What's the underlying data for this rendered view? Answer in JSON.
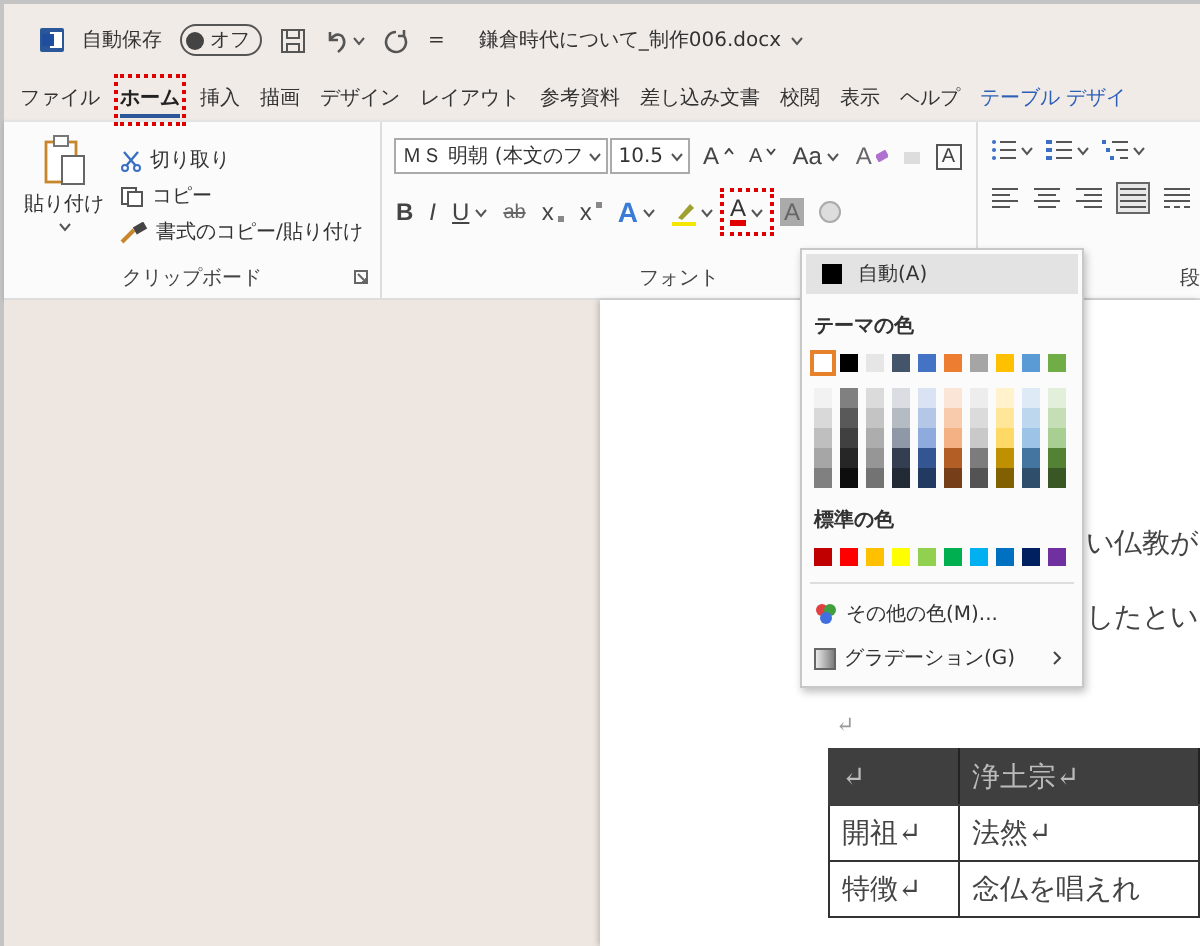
{
  "title_bar": {
    "autosave_label": "自動保存",
    "autosave_toggle": {
      "label": "オフ",
      "on": false
    },
    "customize": "=",
    "file_name": "鎌倉時代について_制作006.docx"
  },
  "tabs": [
    {
      "label": "ファイル",
      "selected": false,
      "contextual": false
    },
    {
      "label": "ホーム",
      "selected": true,
      "callout": true,
      "contextual": false
    },
    {
      "label": "挿入",
      "selected": false,
      "contextual": false
    },
    {
      "label": "描画",
      "selected": false,
      "contextual": false
    },
    {
      "label": "デザイン",
      "selected": false,
      "contextual": false
    },
    {
      "label": "レイアウト",
      "selected": false,
      "contextual": false
    },
    {
      "label": "参考資料",
      "selected": false,
      "contextual": false
    },
    {
      "label": "差し込み文書",
      "selected": false,
      "contextual": false
    },
    {
      "label": "校閲",
      "selected": false,
      "contextual": false
    },
    {
      "label": "表示",
      "selected": false,
      "contextual": false
    },
    {
      "label": "ヘルプ",
      "selected": false,
      "contextual": false
    },
    {
      "label": "テーブル デザイ",
      "selected": false,
      "contextual": true
    }
  ],
  "ribbon": {
    "clipboard": {
      "paste": "貼り付け",
      "cut": "切り取り",
      "copy": "コピー",
      "format_painter": "書式のコピー/貼り付け",
      "label": "クリップボード"
    },
    "font": {
      "font_name": "ＭＳ 明朝 (本文のフ",
      "font_size": "10.5",
      "row1": [
        {
          "kind": "grow",
          "label": "A"
        },
        {
          "kind": "shrink",
          "label": "A"
        },
        {
          "kind": "case",
          "label": "Aa",
          "dropdown": true
        },
        {
          "kind": "clear",
          "label": "A"
        },
        {
          "kind": "ruby",
          "disabled": true
        },
        {
          "kind": "border",
          "label": "A"
        }
      ],
      "row2": [
        {
          "kind": "bold",
          "label": "B"
        },
        {
          "kind": "italic",
          "label": "I"
        },
        {
          "kind": "underline",
          "label": "U",
          "dropdown": true
        },
        {
          "kind": "strike",
          "label": "ab"
        },
        {
          "kind": "subscript",
          "label": "x"
        },
        {
          "kind": "superscript",
          "label": "x"
        },
        {
          "kind": "effects",
          "label": "A",
          "dropdown": true
        },
        {
          "kind": "highlight",
          "dropdown": true
        },
        {
          "kind": "fontcolor",
          "label": "A",
          "dropdown": true,
          "callout": true
        },
        {
          "kind": "shading",
          "label": "A"
        },
        {
          "kind": "enclose"
        }
      ],
      "label": "フォント"
    },
    "paragraph": {
      "row1": [
        {
          "kind": "bullets"
        },
        {
          "kind": "numbering"
        },
        {
          "kind": "multilevel"
        }
      ],
      "row2": [
        {
          "kind": "left",
          "selected": false
        },
        {
          "kind": "center",
          "selected": false
        },
        {
          "kind": "right",
          "selected": false
        },
        {
          "kind": "justify",
          "selected": true
        },
        {
          "kind": "distributed",
          "selected": false
        }
      ],
      "label": "段"
    }
  },
  "font_color_menu": {
    "automatic": {
      "label": "自動(A)",
      "color": "#000000",
      "highlighted": true
    },
    "theme_heading": "テーマの色",
    "theme_colors": [
      {
        "color": "#ffffff",
        "selected": true
      },
      {
        "color": "#000000",
        "selected": false
      },
      {
        "color": "#e7e6e6",
        "selected": false
      },
      {
        "color": "#44546a",
        "selected": false
      },
      {
        "color": "#4472c4",
        "selected": false
      },
      {
        "color": "#ed7d31",
        "selected": false
      },
      {
        "color": "#a5a5a5",
        "selected": false
      },
      {
        "color": "#ffc000",
        "selected": false
      },
      {
        "color": "#5b9bd5",
        "selected": false
      },
      {
        "color": "#70ad47",
        "selected": false
      }
    ],
    "standard_heading": "標準の色",
    "standard_colors": [
      {
        "color": "#c00000"
      },
      {
        "color": "#ff0000"
      },
      {
        "color": "#ffc000"
      },
      {
        "color": "#ffff00"
      },
      {
        "color": "#92d050"
      },
      {
        "color": "#00b050"
      },
      {
        "color": "#00b0f0"
      },
      {
        "color": "#0070c0"
      },
      {
        "color": "#002060"
      },
      {
        "color": "#7030a0"
      }
    ],
    "more_colors": "その他の色(M)...",
    "gradient": {
      "label": "グラデーション(G)",
      "submenu": true
    }
  },
  "document": {
    "lines": [
      "い仏教が",
      "したとい"
    ],
    "return_mark": "↵",
    "table": {
      "rows": [
        {
          "header": true,
          "cells": [
            "↵",
            "浄土宗↵"
          ]
        },
        {
          "header": false,
          "cells": [
            "開祖↵",
            "法然↵"
          ]
        },
        {
          "header": false,
          "cells": [
            "特徴↵",
            "念仏を唱えれ"
          ]
        }
      ]
    }
  }
}
